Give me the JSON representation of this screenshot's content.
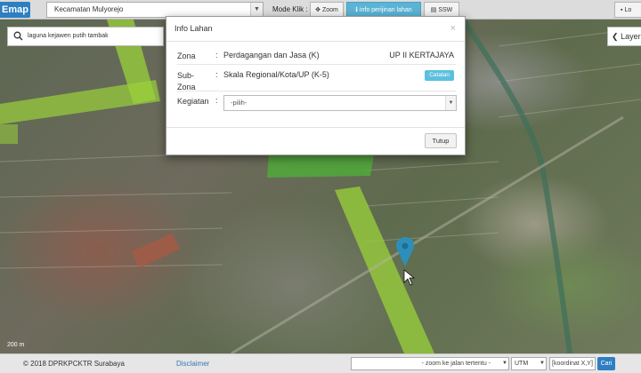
{
  "app": {
    "logo": "Emap"
  },
  "toolbar": {
    "kecamatan_value": "Kecamatan Mulyorejo",
    "mode_label": "Mode Klik :",
    "zoom_btn": "Zoom",
    "info_btn": "info perijinan lahan",
    "ssw_btn": "SSW",
    "log_btn": "Lo"
  },
  "map": {
    "search_value": "laguna kejawen putih tambak",
    "layer_label": "Layer",
    "scale_label": "200 m",
    "zona_color": "#9ad23a"
  },
  "modal": {
    "title": "Info Lahan",
    "close": "×",
    "zona_label": "Zona",
    "zona_value": "Perdagangan dan Jasa (K)",
    "up_value": "UP II KERTAJAYA",
    "subzona_label": "Sub-\nZona",
    "subzona_value": "Skala Regional/Kota/UP (K-5)",
    "catatan_label": "Catatan",
    "kegiatan_label": "Kegiatan",
    "kegiatan_value": "-pilih-",
    "tutup_label": "Tutup",
    "colon": ":"
  },
  "footer": {
    "copyright": "© 2018 DPRKPCKTR Surabaya",
    "disclaimer": "Disclaimer",
    "zoom_select": "- zoom ke jalan tertentu -",
    "utm_value": "UTM",
    "coord_placeholder": "[koordinat X,Y]",
    "cari_label": "Cari"
  },
  "icons": {
    "search": "search-icon",
    "layer": "chevron-left-icon",
    "pin": "map-pin-icon",
    "zoom": "crosshair-icon",
    "info": "info-icon",
    "ssw": "ssw-icon",
    "login": "login-icon"
  }
}
